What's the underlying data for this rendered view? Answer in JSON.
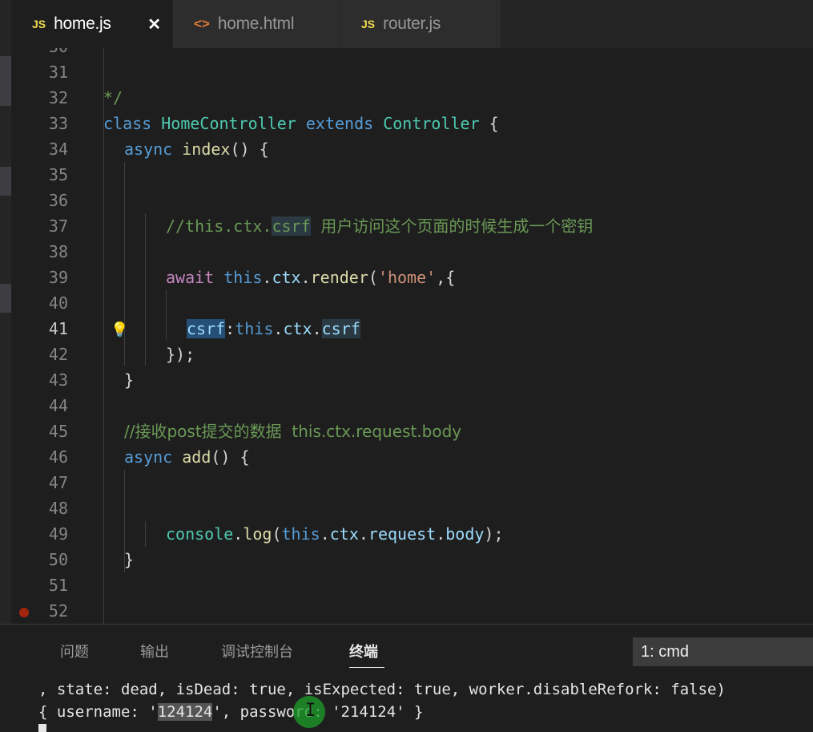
{
  "tabs": [
    {
      "icon": "JS",
      "label": "home.js",
      "close": "✕"
    },
    {
      "icon": "<>",
      "label": "home.html"
    },
    {
      "icon": "JS",
      "label": "router.js"
    }
  ],
  "editor": {
    "current_line": 41,
    "breakpoint_line": 52,
    "lines": [
      {
        "n": "31"
      },
      {
        "n": "32",
        "t1": "*/"
      },
      {
        "n": "33",
        "t1": "class ",
        "t2": "HomeController",
        "t3": " extends ",
        "t4": "Controller",
        "t5": " {"
      },
      {
        "n": "34",
        "t1": "async ",
        "t2": "index",
        "t3": "() {"
      },
      {
        "n": "35"
      },
      {
        "n": "36"
      },
      {
        "n": "37",
        "t1": "//this.ctx.",
        "t2": "csrf",
        "t3": "  用户访问这个页面的时候生成一个密钥"
      },
      {
        "n": "38"
      },
      {
        "n": "39",
        "t1": "await ",
        "t2": "this",
        "t3": ".",
        "t4": "ctx",
        "t5": ".",
        "t6": "render",
        "t7": "(",
        "t8": "'home'",
        "t9": ",{"
      },
      {
        "n": "40"
      },
      {
        "n": "41",
        "t1": "csrf",
        "t2": ":",
        "t3": "this",
        "t4": ".",
        "t5": "ctx",
        "t6": ".",
        "t7": "csrf"
      },
      {
        "n": "42",
        "t1": "});"
      },
      {
        "n": "43",
        "t1": "}"
      },
      {
        "n": "44"
      },
      {
        "n": "45",
        "t1": "//接收post提交的数据  this.ctx.request.body"
      },
      {
        "n": "46",
        "t1": "async ",
        "t2": "add",
        "t3": "() {"
      },
      {
        "n": "47"
      },
      {
        "n": "48"
      },
      {
        "n": "49",
        "t1": "console",
        "t2": ".",
        "t3": "log",
        "t4": "(",
        "t5": "this",
        "t6": ".",
        "t7": "ctx",
        "t8": ".",
        "t9": "request",
        "t10": ".",
        "t11": "body",
        "t12": ");"
      },
      {
        "n": "50",
        "t1": "}"
      },
      {
        "n": "51"
      },
      {
        "n": "52"
      }
    ]
  },
  "panel": {
    "tabs": [
      "问题",
      "输出",
      "调试控制台",
      "终端"
    ],
    "active_tab": "终端",
    "terminal_select": "1: cmd",
    "terminal_lines": [
      ", state: dead, isDead: true, isExpected: true, worker.disableRefork: false)",
      {
        "a": "{ username: '",
        "sel": "124124",
        "b": "', password: '214124' }"
      }
    ]
  },
  "colors": {
    "background": "#1e1e1e",
    "keyword": "#569cd6",
    "comment": "#6a9955",
    "class": "#4ec9b0",
    "function": "#dcdcaa",
    "string": "#ce9178",
    "variable": "#9cdcfe",
    "control_keyword": "#c586c0"
  }
}
